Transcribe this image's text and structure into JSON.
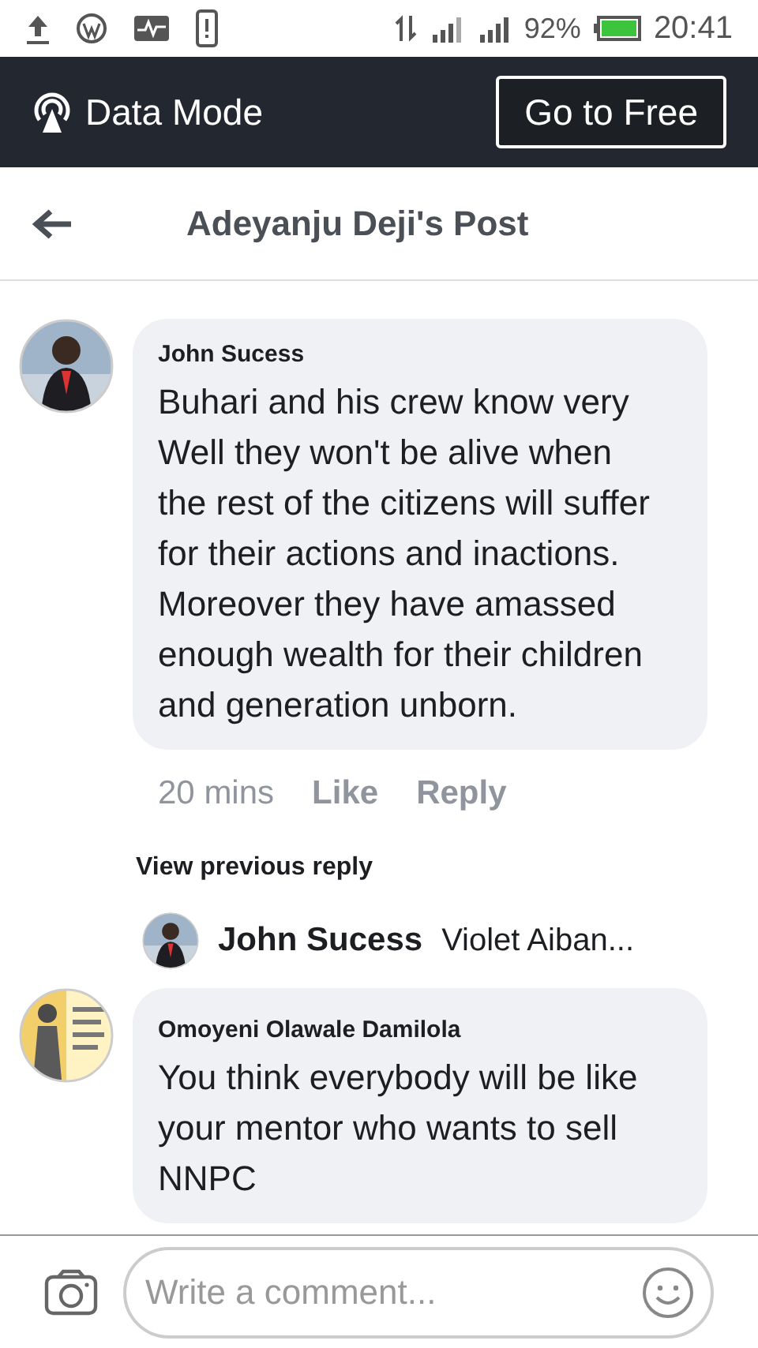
{
  "status_bar": {
    "battery": "92%",
    "time": "20:41"
  },
  "data_banner": {
    "label": "Data Mode",
    "button": "Go to Free"
  },
  "header": {
    "title": "Adeyanju Deji's Post"
  },
  "comments": [
    {
      "author": "John Sucess",
      "text": "Buhari and his crew know very Well they won't be alive when the rest of the citizens will suffer for their actions and inactions. Moreover they have amassed enough wealth for their children and generation unborn.",
      "time": "20 mins",
      "like": "Like",
      "reply": "Reply",
      "view_previous": "View previous reply",
      "reply_preview": {
        "author": "John Sucess",
        "text": "Violet Aiban..."
      }
    },
    {
      "author": "Omoyeni Olawale Damilola",
      "text": "You think everybody will be like your mentor who wants to sell NNPC"
    }
  ],
  "composer": {
    "placeholder": "Write a comment..."
  }
}
